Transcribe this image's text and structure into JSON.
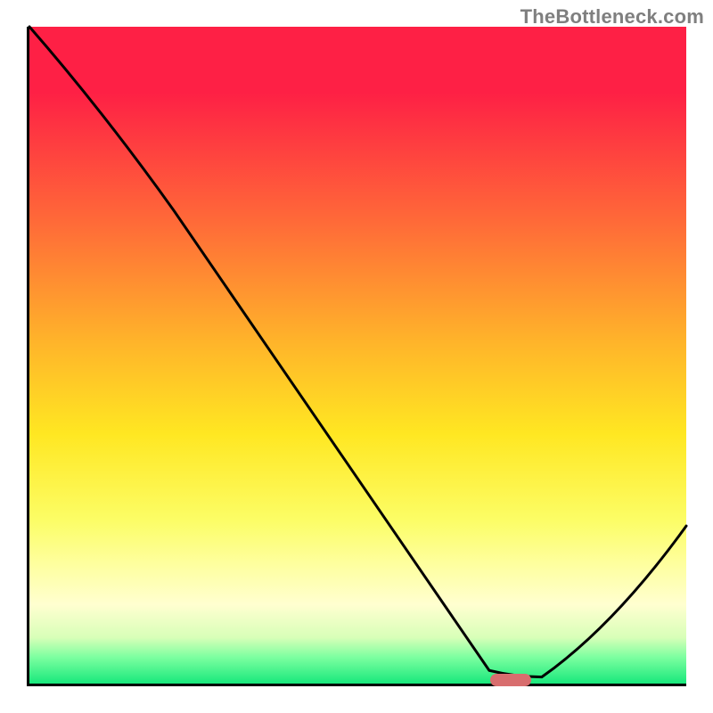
{
  "attribution": "TheBottleneck.com",
  "chart_data": {
    "type": "line",
    "title": "",
    "xlabel": "",
    "ylabel": "",
    "xlim": [
      0,
      100
    ],
    "ylim": [
      0,
      100
    ],
    "series": [
      {
        "name": "bottleneck-curve",
        "x": [
          0,
          22,
          70,
          78,
          100
        ],
        "values": [
          100,
          72,
          2,
          1,
          24
        ]
      }
    ],
    "optimum_marker": {
      "x": 73,
      "y": 1
    },
    "gradient_stops": [
      {
        "pos": 0,
        "color": "#fe2045"
      },
      {
        "pos": 10,
        "color": "#fe2045"
      },
      {
        "pos": 30,
        "color": "#ff6b38"
      },
      {
        "pos": 48,
        "color": "#ffb42a"
      },
      {
        "pos": 62,
        "color": "#ffe722"
      },
      {
        "pos": 75,
        "color": "#fcfd65"
      },
      {
        "pos": 82,
        "color": "#feffa0"
      },
      {
        "pos": 88,
        "color": "#ffffd0"
      },
      {
        "pos": 93,
        "color": "#d8ffb8"
      },
      {
        "pos": 96,
        "color": "#7cffa0"
      },
      {
        "pos": 100,
        "color": "#18e87c"
      }
    ]
  }
}
